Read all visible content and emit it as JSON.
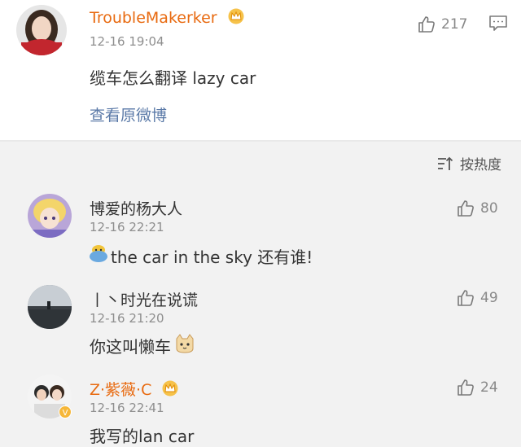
{
  "main_post": {
    "username": "TroubleMakerker",
    "time": "12-16 19:04",
    "likes": "217",
    "content": "缆车怎么翻译 lazy car",
    "view_original": "查看原微博"
  },
  "sort": {
    "label": "按热度"
  },
  "replies": [
    {
      "username": "博爱的杨大人",
      "time": "12-16 22:21",
      "likes": "80",
      "content": "the car in the sky 还有谁!"
    },
    {
      "username": "丨丶时光在说谎",
      "time": "12-16 21:20",
      "likes": "49",
      "content": "你这叫懒车"
    },
    {
      "username": "Z·紫薇·C",
      "time": "12-16 22:41",
      "likes": "24",
      "content": "我写的lan car"
    }
  ],
  "colors": {
    "vip_name": "#e86a10",
    "link": "#5b7aa8",
    "text": "#333333",
    "muted": "#8e8e8e"
  },
  "icons": [
    "thumbs-up-icon",
    "more-comment-icon",
    "crown-icon",
    "sort-icon",
    "emoji-icon",
    "cat-emoji-icon",
    "verified-icon"
  ]
}
